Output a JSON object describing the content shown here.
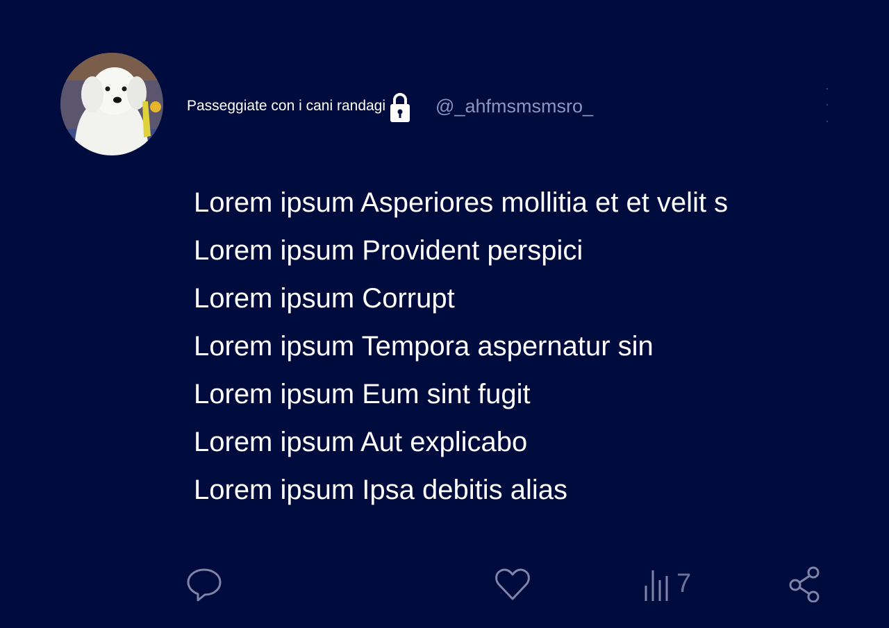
{
  "post": {
    "author": {
      "display_name": "Passeggiate con i cani randagi",
      "handle": "@_ahfmsmsmsro_",
      "protected": true,
      "avatar_description": "white fluffy dog photo"
    },
    "body_lines": [
      "Lorem ipsum Asperiores mollitia et et velit s",
      "Lorem ipsum Provident perspici",
      "Lorem ipsum Corrupt",
      "Lorem ipsum Tempora aspernatur sin",
      "Lorem ipsum Eum sint fugit",
      "Lorem ipsum Aut explicabo",
      "Lorem ipsum Ipsa debitis alias"
    ],
    "actions": {
      "reply_icon": "comment-icon",
      "like_icon": "heart-icon",
      "views_icon": "bar-chart-icon",
      "views_count": "7",
      "share_icon": "share-icon"
    }
  },
  "colors": {
    "background": "#000b3d",
    "text": "#ffffff",
    "handle": "#8e93c0",
    "icon": "#7f84a8"
  }
}
